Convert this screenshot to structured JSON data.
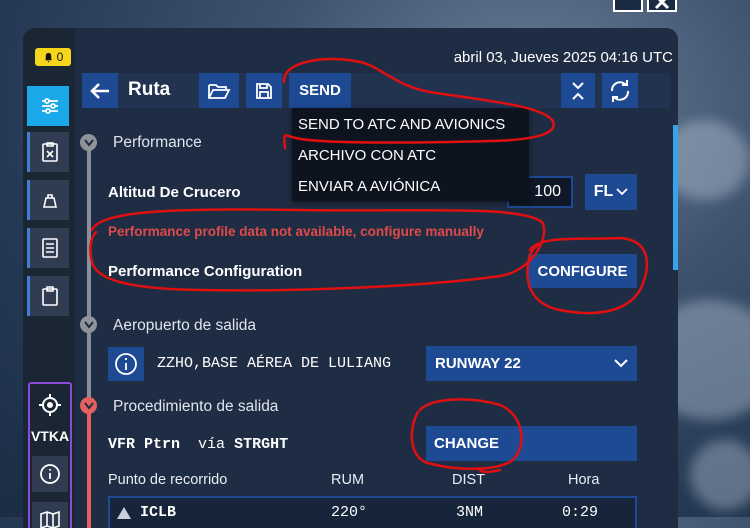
{
  "window": {
    "close_icon": "close-icon",
    "restore_icon": "restore-icon"
  },
  "alerts": {
    "count": "0",
    "icon": "bell-icon"
  },
  "datetime": "abril 03, Jueves 2025 04:16 UTC",
  "toolbar": {
    "back_icon": "arrow-left-icon",
    "title": "Ruta",
    "open_icon": "folder-open-icon",
    "save_icon": "save-icon",
    "send_label": "SEND",
    "collapse_icon": "collapse-icon",
    "refresh_icon": "refresh-icon"
  },
  "send_menu": {
    "items": [
      "SEND TO ATC AND AVIONICS",
      "ARCHIVO CON ATC",
      "ENVIAR A AVIÓNICA"
    ]
  },
  "sidebar": {
    "items": [
      "sliders-icon",
      "checklist-icon",
      "weight-icon",
      "book-icon",
      "clipboard-icon"
    ],
    "vtka_label": "VTKA",
    "vtka_icons": [
      "target-icon",
      "info-icon",
      "map-icon"
    ]
  },
  "performance": {
    "section_title": "Performance",
    "cruise_label": "Altitud De Crucero",
    "cruise_value": "100",
    "cruise_unit": "FL",
    "error": "Performance profile data not available, configure manually",
    "config_label": "Performance Configuration",
    "configure_button": "CONFIGURE"
  },
  "departure_airport": {
    "section_title": "Aeropuerto de salida",
    "airport": "ZZHO,BASE AÉREA DE LULIANG",
    "runway": "RUNWAY 22"
  },
  "departure_procedure": {
    "section_title": "Procedimiento de salida",
    "procedure": "VFR Ptrn",
    "via_label": "vía",
    "via_value": "STRGHT",
    "change_button": "CHANGE"
  },
  "waypoints": {
    "headers": [
      "Punto de recorrido",
      "RUM",
      "DIST",
      "Hora"
    ],
    "rows": [
      {
        "name": "ICLB",
        "rum": "220°",
        "dist": "3NM",
        "time": "0:29"
      }
    ]
  },
  "colors": {
    "panel_bg": "#1f2d44",
    "button_blue": "#1e4a94",
    "accent_cyan": "#1aa8e8",
    "error_red": "#e04a4a",
    "annotation_red": "#e01010",
    "badge_yellow": "#f6d61b",
    "vtka_purple": "#8a4bd6"
  }
}
